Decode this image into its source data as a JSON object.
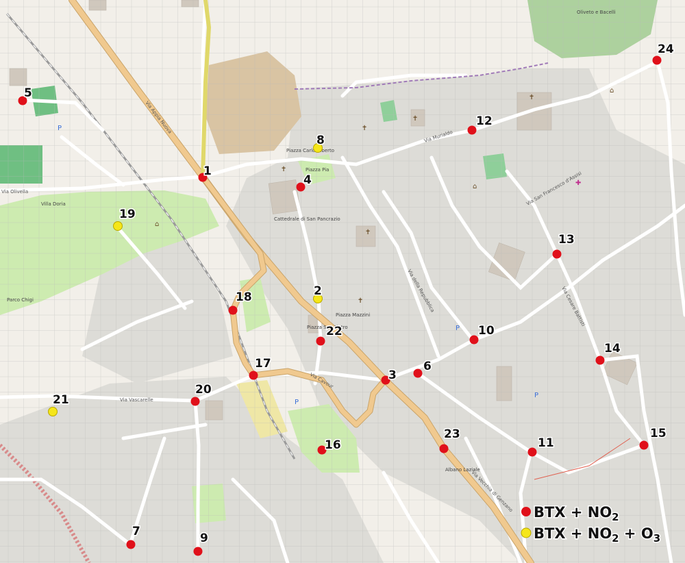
{
  "colors": {
    "red_marker": "#e0101a",
    "yellow_marker": "#f5e61a",
    "main_road": "#f0c98f",
    "park_green": "#cdebb0",
    "dark_green": "#add19e",
    "urban_gray": "#dddcd7",
    "background": "#f2efe9",
    "grid": "#b9b9b9"
  },
  "markers": [
    {
      "id": "1",
      "label": "1",
      "type": "BTX + NO2"
    },
    {
      "id": "2",
      "label": "2",
      "type": "BTX + NO2 + O3"
    },
    {
      "id": "3",
      "label": "3",
      "type": "BTX + NO2"
    },
    {
      "id": "4",
      "label": "4",
      "type": "BTX + NO2"
    },
    {
      "id": "5",
      "label": "5",
      "type": "BTX + NO2"
    },
    {
      "id": "6",
      "label": "6",
      "type": "BTX + NO2"
    },
    {
      "id": "7",
      "label": "7",
      "type": "BTX + NO2"
    },
    {
      "id": "8",
      "label": "8",
      "type": "BTX + NO2 + O3"
    },
    {
      "id": "9",
      "label": "9",
      "type": "BTX + NO2"
    },
    {
      "id": "10",
      "label": "10",
      "type": "BTX + NO2"
    },
    {
      "id": "11",
      "label": "11",
      "type": "BTX + NO2"
    },
    {
      "id": "12",
      "label": "12",
      "type": "BTX + NO2"
    },
    {
      "id": "13",
      "label": "13",
      "type": "BTX + NO2"
    },
    {
      "id": "14",
      "label": "14",
      "type": "BTX + NO2"
    },
    {
      "id": "15",
      "label": "15",
      "type": "BTX + NO2"
    },
    {
      "id": "16",
      "label": "16",
      "type": "BTX + NO2"
    },
    {
      "id": "17",
      "label": "17",
      "type": "BTX + NO2"
    },
    {
      "id": "18",
      "label": "18",
      "type": "BTX + NO2"
    },
    {
      "id": "19",
      "label": "19",
      "type": "BTX + NO2 + O3"
    },
    {
      "id": "20",
      "label": "20",
      "type": "BTX + NO2"
    },
    {
      "id": "21",
      "label": "21",
      "type": "BTX + NO2 + O3"
    },
    {
      "id": "22",
      "label": "22",
      "type": "BTX + NO2"
    },
    {
      "id": "23",
      "label": "23",
      "type": "BTX + NO2"
    },
    {
      "id": "24",
      "label": "24",
      "type": "BTX + NO2"
    }
  ],
  "legend": {
    "red": {
      "base": "BTX + NO",
      "sub": "2"
    },
    "yellow": {
      "base": "BTX + NO",
      "sub": "2",
      "mid": " + O",
      "sub2": "3"
    }
  },
  "streets": {
    "via_appia": "Via Appia Nuova",
    "via_cavour": "Via Cavour",
    "via_vascarelle": "Via Vascarelle",
    "via_olivella": "Via Olivella",
    "via_della_repubblica": "Via della Repubblica",
    "via_murialdo": "Via Murialdo",
    "via_san_francesco": "Via San Francesco d'Assisi",
    "via_cesare_battisti": "Via Cesare Battisti",
    "via_vecchia": "Via Vecchia di Genzano"
  },
  "places": {
    "piazza_carlo": "Piazza Carlo Alberto",
    "piazza_pia": "Piazza Pia",
    "piazza_san_pietro": "Piazza San Pietro",
    "piazza_mazzini": "Piazza Mazzini",
    "albano_laziale": "Albano Laziale",
    "villa_doria": "Villa Doria",
    "parco_chigi": "Parco Chigi",
    "cattedrale": "Cattedrale di San Pancrazio",
    "oliveto": "Oliveto e Bacelli"
  }
}
